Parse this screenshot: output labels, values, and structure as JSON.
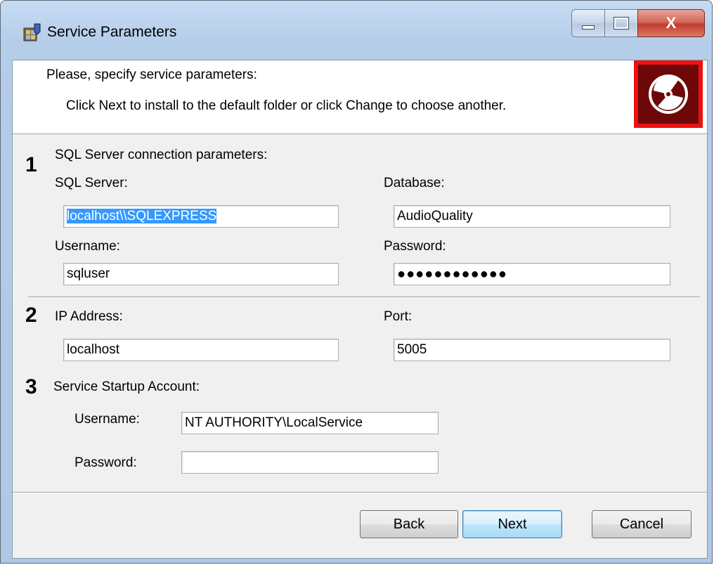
{
  "window": {
    "title": "Service Parameters",
    "controls": {
      "minimize": "minimize",
      "maximize": "maximize",
      "close": "X"
    }
  },
  "banner": {
    "heading": "Please, specify service parameters:",
    "description": "Click Next to install to the default folder or click Change to choose another.",
    "logo_icon": "disc-icon"
  },
  "section1": {
    "number": "1",
    "title": "SQL Server connection parameters:",
    "sql_server_label": "SQL Server:",
    "sql_server_value": "localhost\\\\SQLEXPRESS",
    "database_label": "Database:",
    "database_value": "AudioQuality",
    "username_label": "Username:",
    "username_value": "sqluser",
    "password_label": "Password:",
    "password_value": "●●●●●●●●●●●●"
  },
  "section2": {
    "number": "2",
    "ip_label": "IP Address:",
    "ip_value": "localhost",
    "port_label": "Port:",
    "port_value": "5005"
  },
  "section3": {
    "number": "3",
    "title": "Service Startup Account:",
    "username_label": "Username:",
    "username_value": "NT AUTHORITY\\LocalService",
    "password_label": "Password:",
    "password_value": ""
  },
  "buttons": {
    "back": "Back",
    "next": "Next",
    "cancel": "Cancel"
  },
  "colors": {
    "selection": "#3399ff",
    "logo_red": "#ee1111",
    "logo_dark": "#6e0808"
  }
}
